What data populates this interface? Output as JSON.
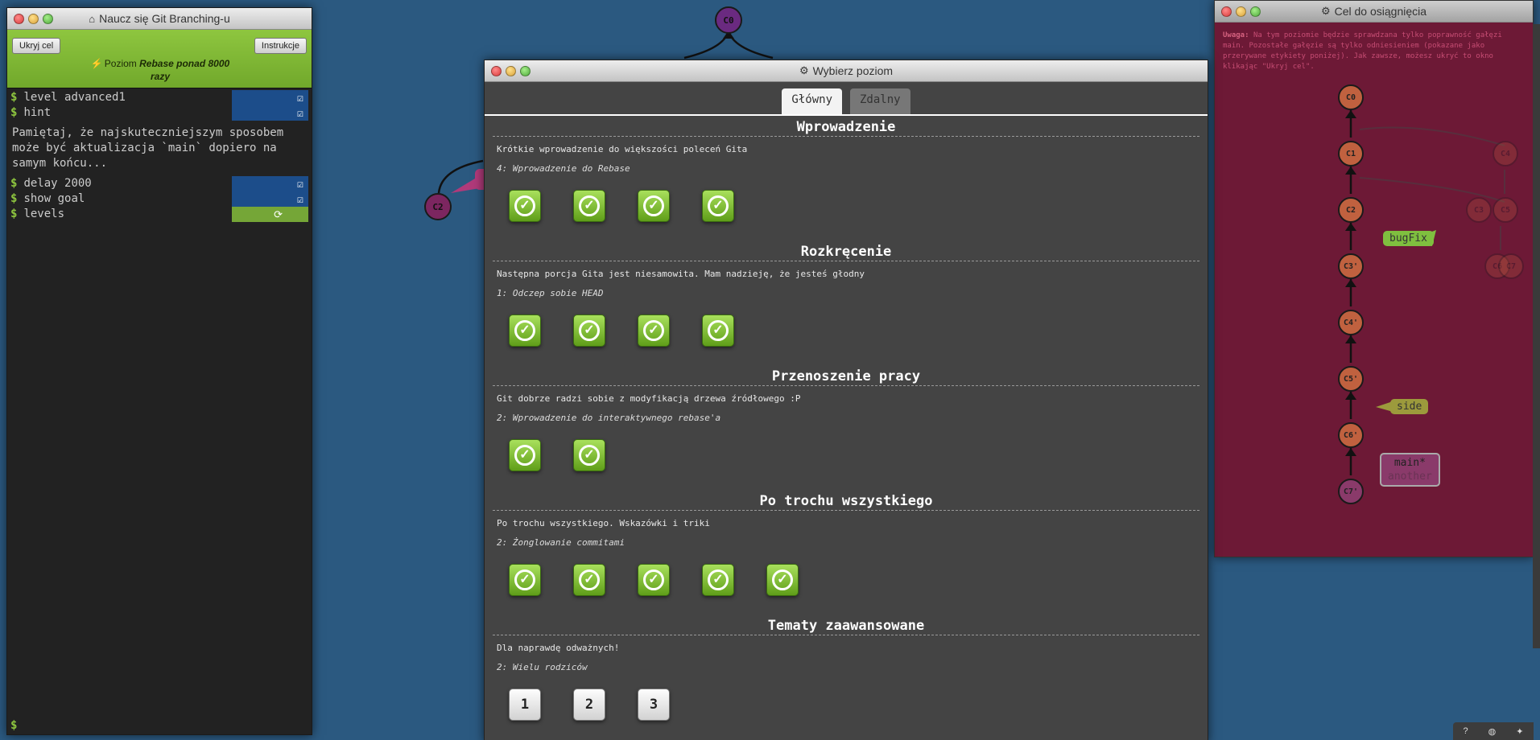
{
  "terminal": {
    "title": "Naucz się Git Branching-u",
    "title_icon": "home-icon",
    "hide_goal_label": "Ukryj cel",
    "instructions_label": "Instrukcje",
    "level_prefix": "Poziom",
    "level_name": "Rebase ponad 8000 razy",
    "commands": [
      {
        "text": "level advanced1",
        "status": "check"
      },
      {
        "text": "hint",
        "status": "check"
      }
    ],
    "hint_text": "Pamiętaj, że najskuteczniejszym sposobem może być aktualizacja `main` dopiero na samym końcu...",
    "commands2": [
      {
        "text": "delay 2000",
        "status": "check"
      },
      {
        "text": "show goal",
        "status": "check"
      },
      {
        "text": "levels",
        "status": "refresh"
      }
    ],
    "prompt": "$"
  },
  "graph": {
    "c0": "C0",
    "c2": "C2",
    "c2_color": "#7c2660"
  },
  "goal": {
    "title": "Cel do osiągnięcia",
    "title_icon": "gear-icon",
    "note_label": "Uwaga:",
    "note_text": "Na tym poziomie będzie sprawdzana tylko poprawność gałęzi main. Pozostałe gałęzie są tylko odniesieniem (pokazane jako przerywane etykiety poniżej). Jak zawsze, możesz ukryć to okno klikając \"Ukryj cel\".",
    "commits": [
      "C0",
      "C1",
      "C2",
      "C3'",
      "C4'",
      "C5'",
      "C6'",
      "C7'"
    ],
    "faded_commits": [
      "C4",
      "C3",
      "C5",
      "C6",
      "C7"
    ],
    "labels": {
      "bugfix": "bugFix",
      "side": "side",
      "main": "main*",
      "another": "another"
    }
  },
  "levels": {
    "title": "Wybierz poziom",
    "title_icon": "gear-icon",
    "tabs": [
      {
        "label": "Główny",
        "active": true
      },
      {
        "label": "Zdalny",
        "active": false
      }
    ],
    "sequences": [
      {
        "title": "Wprowadzenie",
        "desc": "Krótkie wprowadzenie do większości poleceń Gita",
        "sub": "4: Wprowadzenie do Rebase",
        "levels": 4,
        "type": "check"
      },
      {
        "title": "Rozkręcenie",
        "desc": "Następna porcja Gita jest niesamowita. Mam nadzieję, że jesteś głodny",
        "sub": "1: Odczep sobie HEAD",
        "levels": 4,
        "type": "check"
      },
      {
        "title": "Przenoszenie pracy",
        "desc": "Git dobrze radzi sobie z modyfikacją drzewa źródłowego :P",
        "sub": "2: Wprowadzenie do interaktywnego rebase'a",
        "levels": 2,
        "type": "check"
      },
      {
        "title": "Po trochu wszystkiego",
        "desc": "Po trochu wszystkiego. Wskazówki i triki",
        "sub": "2: Żonglowanie commitami",
        "levels": 5,
        "type": "check"
      },
      {
        "title": "Tematy zaawansowane",
        "desc": "Dla naprawdę odważnych!",
        "sub": "2: Wielu rodziców",
        "levels": [
          "1",
          "2",
          "3"
        ],
        "type": "number"
      }
    ]
  },
  "colors": {
    "background": "#2b5980",
    "level_bar": "#8ec63f",
    "goal_bg": "#6d1936",
    "commit": "#c0613f",
    "bugfix_label": "#7fbf3f",
    "side_label": "#9c9a3c"
  }
}
